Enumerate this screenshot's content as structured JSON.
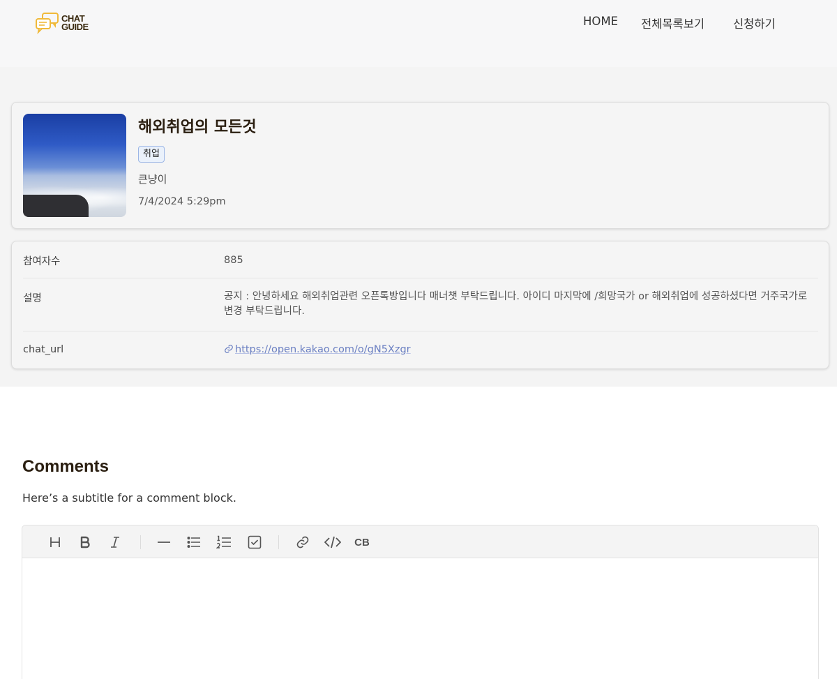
{
  "header": {
    "logo_line1": "CHAT",
    "logo_line2": "GUIDE",
    "nav": [
      "HOME",
      "전체목록보기",
      "신청하기"
    ]
  },
  "room": {
    "title": "해외취업의 모든것",
    "tag": "취업",
    "author": "큰냥이",
    "date": "7/4/2024 5:29pm"
  },
  "details": {
    "participants_label": "참여자수",
    "participants_value": "885",
    "description_label": "설명",
    "description_value": "공지 : 안녕하세요 해외취업관련 오픈톡방입니다 매너챗 부탁드립니다. 아이디 마지막에 /희망국가 or 해외취업에 성공하셨다면 거주국가로 변경 부탁드립니다.",
    "url_label": "chat_url",
    "url_value": "https://open.kakao.com/o/gN5Xzgr"
  },
  "comments": {
    "title": "Comments",
    "subtitle": "Here’s a subtitle for a comment block."
  },
  "editor": {
    "toolbar": [
      "heading-icon",
      "bold-icon",
      "italic-icon",
      "horizontal-rule-icon",
      "bullet-list-icon",
      "numbered-list-icon",
      "checkbox-icon",
      "link-icon",
      "code-icon",
      "code-block-icon"
    ],
    "codeblock_label": "CB"
  },
  "colors": {
    "accent_logo": "#f0b93a",
    "title_text": "#2a1e10",
    "link": "#6a7fc2",
    "tag_border": "#9bb6e6"
  }
}
